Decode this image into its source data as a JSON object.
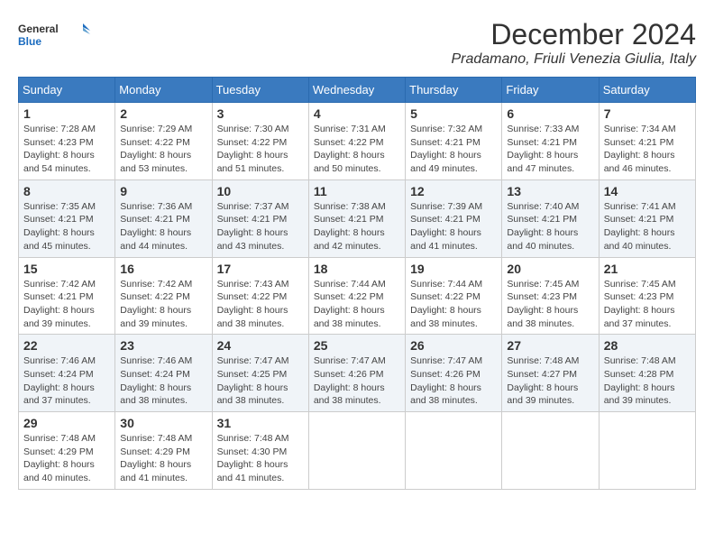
{
  "logo": {
    "text_general": "General",
    "text_blue": "Blue"
  },
  "header": {
    "month_year": "December 2024",
    "location": "Pradamano, Friuli Venezia Giulia, Italy"
  },
  "weekdays": [
    "Sunday",
    "Monday",
    "Tuesday",
    "Wednesday",
    "Thursday",
    "Friday",
    "Saturday"
  ],
  "weeks": [
    [
      {
        "day": "1",
        "sunrise": "Sunrise: 7:28 AM",
        "sunset": "Sunset: 4:23 PM",
        "daylight": "Daylight: 8 hours and 54 minutes."
      },
      {
        "day": "2",
        "sunrise": "Sunrise: 7:29 AM",
        "sunset": "Sunset: 4:22 PM",
        "daylight": "Daylight: 8 hours and 53 minutes."
      },
      {
        "day": "3",
        "sunrise": "Sunrise: 7:30 AM",
        "sunset": "Sunset: 4:22 PM",
        "daylight": "Daylight: 8 hours and 51 minutes."
      },
      {
        "day": "4",
        "sunrise": "Sunrise: 7:31 AM",
        "sunset": "Sunset: 4:22 PM",
        "daylight": "Daylight: 8 hours and 50 minutes."
      },
      {
        "day": "5",
        "sunrise": "Sunrise: 7:32 AM",
        "sunset": "Sunset: 4:21 PM",
        "daylight": "Daylight: 8 hours and 49 minutes."
      },
      {
        "day": "6",
        "sunrise": "Sunrise: 7:33 AM",
        "sunset": "Sunset: 4:21 PM",
        "daylight": "Daylight: 8 hours and 47 minutes."
      },
      {
        "day": "7",
        "sunrise": "Sunrise: 7:34 AM",
        "sunset": "Sunset: 4:21 PM",
        "daylight": "Daylight: 8 hours and 46 minutes."
      }
    ],
    [
      {
        "day": "8",
        "sunrise": "Sunrise: 7:35 AM",
        "sunset": "Sunset: 4:21 PM",
        "daylight": "Daylight: 8 hours and 45 minutes."
      },
      {
        "day": "9",
        "sunrise": "Sunrise: 7:36 AM",
        "sunset": "Sunset: 4:21 PM",
        "daylight": "Daylight: 8 hours and 44 minutes."
      },
      {
        "day": "10",
        "sunrise": "Sunrise: 7:37 AM",
        "sunset": "Sunset: 4:21 PM",
        "daylight": "Daylight: 8 hours and 43 minutes."
      },
      {
        "day": "11",
        "sunrise": "Sunrise: 7:38 AM",
        "sunset": "Sunset: 4:21 PM",
        "daylight": "Daylight: 8 hours and 42 minutes."
      },
      {
        "day": "12",
        "sunrise": "Sunrise: 7:39 AM",
        "sunset": "Sunset: 4:21 PM",
        "daylight": "Daylight: 8 hours and 41 minutes."
      },
      {
        "day": "13",
        "sunrise": "Sunrise: 7:40 AM",
        "sunset": "Sunset: 4:21 PM",
        "daylight": "Daylight: 8 hours and 40 minutes."
      },
      {
        "day": "14",
        "sunrise": "Sunrise: 7:41 AM",
        "sunset": "Sunset: 4:21 PM",
        "daylight": "Daylight: 8 hours and 40 minutes."
      }
    ],
    [
      {
        "day": "15",
        "sunrise": "Sunrise: 7:42 AM",
        "sunset": "Sunset: 4:21 PM",
        "daylight": "Daylight: 8 hours and 39 minutes."
      },
      {
        "day": "16",
        "sunrise": "Sunrise: 7:42 AM",
        "sunset": "Sunset: 4:22 PM",
        "daylight": "Daylight: 8 hours and 39 minutes."
      },
      {
        "day": "17",
        "sunrise": "Sunrise: 7:43 AM",
        "sunset": "Sunset: 4:22 PM",
        "daylight": "Daylight: 8 hours and 38 minutes."
      },
      {
        "day": "18",
        "sunrise": "Sunrise: 7:44 AM",
        "sunset": "Sunset: 4:22 PM",
        "daylight": "Daylight: 8 hours and 38 minutes."
      },
      {
        "day": "19",
        "sunrise": "Sunrise: 7:44 AM",
        "sunset": "Sunset: 4:22 PM",
        "daylight": "Daylight: 8 hours and 38 minutes."
      },
      {
        "day": "20",
        "sunrise": "Sunrise: 7:45 AM",
        "sunset": "Sunset: 4:23 PM",
        "daylight": "Daylight: 8 hours and 38 minutes."
      },
      {
        "day": "21",
        "sunrise": "Sunrise: 7:45 AM",
        "sunset": "Sunset: 4:23 PM",
        "daylight": "Daylight: 8 hours and 37 minutes."
      }
    ],
    [
      {
        "day": "22",
        "sunrise": "Sunrise: 7:46 AM",
        "sunset": "Sunset: 4:24 PM",
        "daylight": "Daylight: 8 hours and 37 minutes."
      },
      {
        "day": "23",
        "sunrise": "Sunrise: 7:46 AM",
        "sunset": "Sunset: 4:24 PM",
        "daylight": "Daylight: 8 hours and 38 minutes."
      },
      {
        "day": "24",
        "sunrise": "Sunrise: 7:47 AM",
        "sunset": "Sunset: 4:25 PM",
        "daylight": "Daylight: 8 hours and 38 minutes."
      },
      {
        "day": "25",
        "sunrise": "Sunrise: 7:47 AM",
        "sunset": "Sunset: 4:26 PM",
        "daylight": "Daylight: 8 hours and 38 minutes."
      },
      {
        "day": "26",
        "sunrise": "Sunrise: 7:47 AM",
        "sunset": "Sunset: 4:26 PM",
        "daylight": "Daylight: 8 hours and 38 minutes."
      },
      {
        "day": "27",
        "sunrise": "Sunrise: 7:48 AM",
        "sunset": "Sunset: 4:27 PM",
        "daylight": "Daylight: 8 hours and 39 minutes."
      },
      {
        "day": "28",
        "sunrise": "Sunrise: 7:48 AM",
        "sunset": "Sunset: 4:28 PM",
        "daylight": "Daylight: 8 hours and 39 minutes."
      }
    ],
    [
      {
        "day": "29",
        "sunrise": "Sunrise: 7:48 AM",
        "sunset": "Sunset: 4:29 PM",
        "daylight": "Daylight: 8 hours and 40 minutes."
      },
      {
        "day": "30",
        "sunrise": "Sunrise: 7:48 AM",
        "sunset": "Sunset: 4:29 PM",
        "daylight": "Daylight: 8 hours and 41 minutes."
      },
      {
        "day": "31",
        "sunrise": "Sunrise: 7:48 AM",
        "sunset": "Sunset: 4:30 PM",
        "daylight": "Daylight: 8 hours and 41 minutes."
      },
      null,
      null,
      null,
      null
    ]
  ]
}
